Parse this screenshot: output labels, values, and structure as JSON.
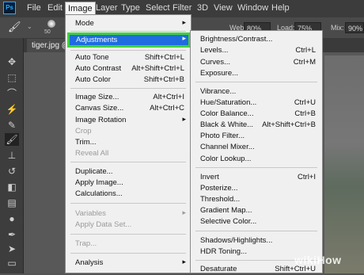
{
  "app": {
    "logo": "Ps"
  },
  "menubar": [
    "File",
    "Edit",
    "Image",
    "Layer",
    "Type",
    "Select",
    "Filter",
    "3D",
    "View",
    "Window",
    "Help"
  ],
  "options": {
    "brush_size": "50",
    "web_label": "Web:",
    "web_value": "80%",
    "load_label": "Load:",
    "load_value": "75%",
    "mix_label": "Mix:",
    "mix_value": "90%"
  },
  "document": {
    "tab": "tiger.jpg @"
  },
  "image_menu": [
    {
      "label": "Mode",
      "submenu": true
    },
    {
      "sep": true
    },
    {
      "label": "Adjustments",
      "submenu": true,
      "highlight": true
    },
    {
      "sep": true
    },
    {
      "label": "Auto Tone",
      "shortcut": "Shift+Ctrl+L"
    },
    {
      "label": "Auto Contrast",
      "shortcut": "Alt+Shift+Ctrl+L"
    },
    {
      "label": "Auto Color",
      "shortcut": "Shift+Ctrl+B"
    },
    {
      "sep": true
    },
    {
      "label": "Image Size...",
      "shortcut": "Alt+Ctrl+I"
    },
    {
      "label": "Canvas Size...",
      "shortcut": "Alt+Ctrl+C"
    },
    {
      "label": "Image Rotation",
      "submenu": true
    },
    {
      "label": "Crop",
      "disabled": true
    },
    {
      "label": "Trim..."
    },
    {
      "label": "Reveal All",
      "disabled": true
    },
    {
      "sep": true
    },
    {
      "label": "Duplicate..."
    },
    {
      "label": "Apply Image..."
    },
    {
      "label": "Calculations..."
    },
    {
      "sep": true
    },
    {
      "label": "Variables",
      "submenu": true,
      "disabled": true
    },
    {
      "label": "Apply Data Set...",
      "disabled": true
    },
    {
      "sep": true
    },
    {
      "label": "Trap...",
      "disabled": true
    },
    {
      "sep": true
    },
    {
      "label": "Analysis",
      "submenu": true
    }
  ],
  "adjustments_menu": [
    {
      "label": "Brightness/Contrast..."
    },
    {
      "label": "Levels...",
      "shortcut": "Ctrl+L"
    },
    {
      "label": "Curves...",
      "shortcut": "Ctrl+M"
    },
    {
      "label": "Exposure..."
    },
    {
      "sep": true
    },
    {
      "label": "Vibrance..."
    },
    {
      "label": "Hue/Saturation...",
      "shortcut": "Ctrl+U"
    },
    {
      "label": "Color Balance...",
      "shortcut": "Ctrl+B"
    },
    {
      "label": "Black & White...",
      "shortcut": "Alt+Shift+Ctrl+B"
    },
    {
      "label": "Photo Filter..."
    },
    {
      "label": "Channel Mixer..."
    },
    {
      "label": "Color Lookup..."
    },
    {
      "sep": true
    },
    {
      "label": "Invert",
      "shortcut": "Ctrl+I"
    },
    {
      "label": "Posterize..."
    },
    {
      "label": "Threshold..."
    },
    {
      "label": "Gradient Map..."
    },
    {
      "label": "Selective Color..."
    },
    {
      "sep": true
    },
    {
      "label": "Shadows/Highlights..."
    },
    {
      "label": "HDR Toning..."
    },
    {
      "sep": true
    },
    {
      "label": "Desaturate",
      "shortcut": "Shift+Ctrl+U"
    }
  ],
  "tools": [
    "move-icon",
    "marquee-icon",
    "lasso-icon",
    "magic-wand-icon",
    "eyedropper-icon",
    "brush-icon",
    "stamp-icon",
    "history-brush-icon",
    "eraser-icon",
    "gradient-icon",
    "dodge-icon",
    "pen-icon",
    "type-icon",
    "path-select-icon",
    "shape-icon",
    "hand-icon"
  ],
  "watermark": "wikiHow",
  "colors": {
    "highlight": "#1e6ce0",
    "highlight_border": "#41d13d",
    "menubar": "#3c3c3c"
  }
}
